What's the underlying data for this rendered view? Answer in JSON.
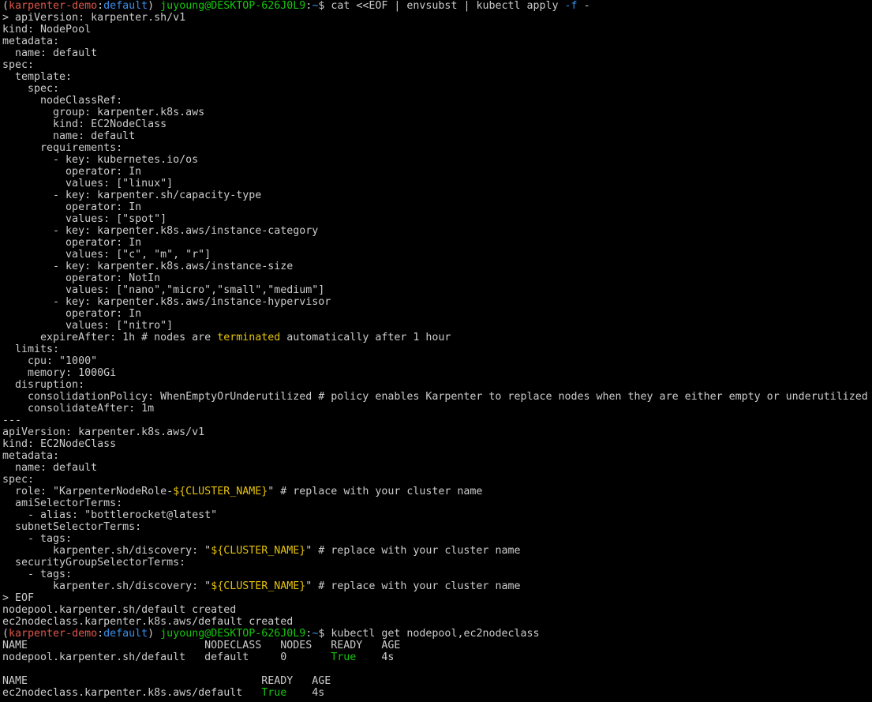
{
  "terminal": {
    "lines": [
      [
        {
          "t": "(",
          "c": "default"
        },
        {
          "t": "karpenter-demo",
          "c": "red"
        },
        {
          "t": ":",
          "c": "default"
        },
        {
          "t": "default",
          "c": "blue"
        },
        {
          "t": ") ",
          "c": "default"
        },
        {
          "t": "juyoung@DESKTOP-626J0L9",
          "c": "green"
        },
        {
          "t": ":",
          "c": "default"
        },
        {
          "t": "~",
          "c": "blue"
        },
        {
          "t": "$ cat <<EOF | envsubst | kubectl apply ",
          "c": "default"
        },
        {
          "t": "-f",
          "c": "blue"
        },
        {
          "t": " -",
          "c": "default"
        }
      ],
      [
        {
          "t": "> apiVersion: karpenter.sh/v1",
          "c": "default"
        }
      ],
      [
        {
          "t": "kind: NodePool",
          "c": "default"
        }
      ],
      [
        {
          "t": "metadata:",
          "c": "default"
        }
      ],
      [
        {
          "t": "  name: default",
          "c": "default"
        }
      ],
      [
        {
          "t": "spec:",
          "c": "default"
        }
      ],
      [
        {
          "t": "  template:",
          "c": "default"
        }
      ],
      [
        {
          "t": "    spec:",
          "c": "default"
        }
      ],
      [
        {
          "t": "      nodeClassRef:",
          "c": "default"
        }
      ],
      [
        {
          "t": "        group: karpenter.k8s.aws",
          "c": "default"
        }
      ],
      [
        {
          "t": "        kind: EC2NodeClass",
          "c": "default"
        }
      ],
      [
        {
          "t": "        name: default",
          "c": "default"
        }
      ],
      [
        {
          "t": "      requirements:",
          "c": "default"
        }
      ],
      [
        {
          "t": "        - key: kubernetes.io/os",
          "c": "default"
        }
      ],
      [
        {
          "t": "          operator: In",
          "c": "default"
        }
      ],
      [
        {
          "t": "          values: [\"linux\"]",
          "c": "default"
        }
      ],
      [
        {
          "t": "        - key: karpenter.sh/capacity-type",
          "c": "default"
        }
      ],
      [
        {
          "t": "          operator: In",
          "c": "default"
        }
      ],
      [
        {
          "t": "          values: [\"spot\"]",
          "c": "default"
        }
      ],
      [
        {
          "t": "        - key: karpenter.k8s.aws/instance-category",
          "c": "default"
        }
      ],
      [
        {
          "t": "          operator: In",
          "c": "default"
        }
      ],
      [
        {
          "t": "          values: [\"c\", \"m\", \"r\"]",
          "c": "default"
        }
      ],
      [
        {
          "t": "        - key: karpenter.k8s.aws/instance-size",
          "c": "default"
        }
      ],
      [
        {
          "t": "          operator: NotIn",
          "c": "default"
        }
      ],
      [
        {
          "t": "          values: [\"nano\",\"micro\",\"small\",\"medium\"]",
          "c": "default"
        }
      ],
      [
        {
          "t": "        - key: karpenter.k8s.aws/instance-hypervisor",
          "c": "default"
        }
      ],
      [
        {
          "t": "          operator: In",
          "c": "default"
        }
      ],
      [
        {
          "t": "          values: [\"nitro\"]",
          "c": "default"
        }
      ],
      [
        {
          "t": "      expireAfter: 1h # nodes are ",
          "c": "default"
        },
        {
          "t": "terminated",
          "c": "gold"
        },
        {
          "t": " automatically after 1 hour",
          "c": "default"
        }
      ],
      [
        {
          "t": "  limits:",
          "c": "default"
        }
      ],
      [
        {
          "t": "    cpu: \"1000\"",
          "c": "default"
        }
      ],
      [
        {
          "t": "    memory: 1000Gi",
          "c": "default"
        }
      ],
      [
        {
          "t": "  disruption:",
          "c": "default"
        }
      ],
      [
        {
          "t": "    consolidationPolicy: WhenEmptyOrUnderutilized # policy enables Karpenter to replace nodes when they are either empty or underutilized",
          "c": "default"
        }
      ],
      [
        {
          "t": "    consolidateAfter: 1m",
          "c": "default"
        }
      ],
      [
        {
          "t": "---",
          "c": "default"
        }
      ],
      [
        {
          "t": "apiVersion: karpenter.k8s.aws/v1",
          "c": "default"
        }
      ],
      [
        {
          "t": "kind: EC2NodeClass",
          "c": "default"
        }
      ],
      [
        {
          "t": "metadata:",
          "c": "default"
        }
      ],
      [
        {
          "t": "  name: default",
          "c": "default"
        }
      ],
      [
        {
          "t": "spec:",
          "c": "default"
        }
      ],
      [
        {
          "t": "  role: \"KarpenterNodeRole-",
          "c": "default"
        },
        {
          "t": "${CLUSTER_NAME}",
          "c": "gold"
        },
        {
          "t": "\" # replace with your cluster name",
          "c": "default"
        }
      ],
      [
        {
          "t": "  amiSelectorTerms:",
          "c": "default"
        }
      ],
      [
        {
          "t": "    - alias: \"bottlerocket@latest\"",
          "c": "default"
        }
      ],
      [
        {
          "t": "  subnetSelectorTerms:",
          "c": "default"
        }
      ],
      [
        {
          "t": "    - tags:",
          "c": "default"
        }
      ],
      [
        {
          "t": "        karpenter.sh/discovery: \"",
          "c": "default"
        },
        {
          "t": "${CLUSTER_NAME}",
          "c": "gold"
        },
        {
          "t": "\" # replace with your cluster name",
          "c": "default"
        }
      ],
      [
        {
          "t": "  securityGroupSelectorTerms:",
          "c": "default"
        }
      ],
      [
        {
          "t": "    - tags:",
          "c": "default"
        }
      ],
      [
        {
          "t": "        karpenter.sh/discovery: \"",
          "c": "default"
        },
        {
          "t": "${CLUSTER_NAME}",
          "c": "gold"
        },
        {
          "t": "\" # replace with your cluster name",
          "c": "default"
        }
      ],
      [
        {
          "t": "> EOF",
          "c": "default"
        }
      ],
      [
        {
          "t": "nodepool.karpenter.sh/default created",
          "c": "default"
        }
      ],
      [
        {
          "t": "ec2nodeclass.karpenter.k8s.aws/default created",
          "c": "default"
        }
      ],
      [
        {
          "t": "(",
          "c": "default"
        },
        {
          "t": "karpenter-demo",
          "c": "red"
        },
        {
          "t": ":",
          "c": "default"
        },
        {
          "t": "default",
          "c": "blue"
        },
        {
          "t": ") ",
          "c": "default"
        },
        {
          "t": "juyoung@DESKTOP-626J0L9",
          "c": "green"
        },
        {
          "t": ":",
          "c": "default"
        },
        {
          "t": "~",
          "c": "blue"
        },
        {
          "t": "$ kubectl get nodepool,ec2nodeclass",
          "c": "default"
        }
      ],
      [
        {
          "t": "NAME                            NODECLASS   NODES   READY   AGE",
          "c": "default"
        }
      ],
      [
        {
          "t": "nodepool.karpenter.sh/default   default     0       ",
          "c": "default"
        },
        {
          "t": "True",
          "c": "green"
        },
        {
          "t": "    4s",
          "c": "default"
        }
      ],
      [
        {
          "t": "",
          "c": "default"
        }
      ],
      [
        {
          "t": "NAME                                     READY   AGE",
          "c": "default"
        }
      ],
      [
        {
          "t": "ec2nodeclass.karpenter.k8s.aws/default   ",
          "c": "default"
        },
        {
          "t": "True",
          "c": "green"
        },
        {
          "t": "    4s",
          "c": "default"
        }
      ]
    ]
  },
  "colors": {
    "background": "#000000",
    "text": "#cccccc",
    "red": "#e0564c",
    "green": "#16c60c",
    "blue": "#3b8eea",
    "gold": "#e5c20a"
  }
}
